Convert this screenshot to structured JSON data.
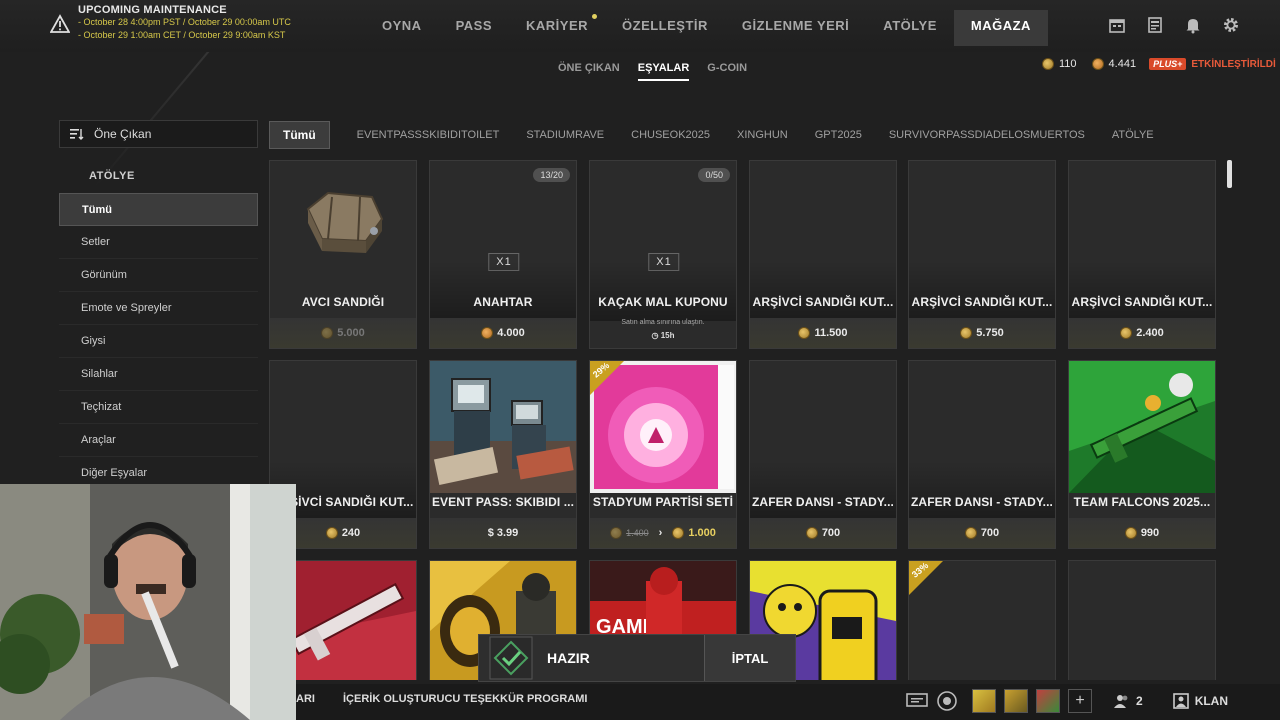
{
  "maintenance": {
    "title": "UPCOMING MAINTENANCE",
    "line1": "- October 28 4:00pm PST / October 29 00:00am UTC",
    "line2": "- October 29 1:00am CET / October 29 9:00am KST"
  },
  "nav": [
    {
      "label": "OYNA"
    },
    {
      "label": "PASS"
    },
    {
      "label": "KARİYER"
    },
    {
      "label": "ÖZELLEŞTİR"
    },
    {
      "label": "GİZLENME YERİ"
    },
    {
      "label": "ATÖLYE"
    },
    {
      "label": "MAĞAZA"
    }
  ],
  "subtabs": [
    "ÖNE ÇIKAN",
    "EŞYALAR",
    "G-COIN"
  ],
  "wallet": {
    "gcoin": "110",
    "bp": "4.441",
    "plus_badge": "PLUS+",
    "plus_status": "ETKİNLEŞTİRİLDİ"
  },
  "sort": {
    "label": "Öne Çıkan"
  },
  "sidebar": {
    "heading": "ATÖLYE",
    "items": [
      "Tümü",
      "Setler",
      "Görünüm",
      "Emote ve Spreyler",
      "Giysi",
      "Silahlar",
      "Teçhizat",
      "Araçlar",
      "Diğer Eşyalar"
    ]
  },
  "filters": [
    "Tümü",
    "EVENTPASSSKIBIDITOILET",
    "STADIUMRAVE",
    "CHUSEOK2025",
    "XINGHUN",
    "GPT2025",
    "SURVIVORPASSDIADELOSMUERTOS",
    "ATÖLYE"
  ],
  "cards": [
    {
      "name": "AVCI SANDIĞI",
      "price": "5.000"
    },
    {
      "name": "ANAHTAR",
      "price": "4.000",
      "counter": "13/20",
      "qty": "X1"
    },
    {
      "name": "KAÇAK MAL KUPONU",
      "counter": "0/50",
      "qty": "X1",
      "note": "Satın alma sınırına ulaştın.",
      "timer": "15h"
    },
    {
      "name": "ARŞİVCİ SANDIĞI KUT...",
      "price": "11.500"
    },
    {
      "name": "ARŞİVCİ SANDIĞI KUT...",
      "price": "5.750"
    },
    {
      "name": "ARŞİVCİ SANDIĞI KUT...",
      "price": "2.400"
    },
    {
      "name": "ARŞİVCİ SANDIĞI KUT...",
      "price": "240"
    },
    {
      "name": "EVENT PASS: SKIBIDI ...",
      "price": "$ 3.99"
    },
    {
      "name": "STADYUM PARTİSİ SETİ",
      "old_price": "1.400",
      "price": "1.000",
      "discount": "29%"
    },
    {
      "name": "ZAFER DANSI - STADY...",
      "price": "700"
    },
    {
      "name": "ZAFER DANSI - STADY...",
      "price": "700"
    },
    {
      "name": "TEAM FALCONS 2025...",
      "price": "990"
    },
    {
      "name": ""
    },
    {
      "name": ""
    },
    {
      "name": ""
    },
    {
      "name": ""
    },
    {
      "name": "",
      "discount": "33%"
    },
    {
      "name": ""
    }
  ],
  "ready": {
    "label": "HAZIR",
    "cancel": "İPTAL"
  },
  "bottom": {
    "left_fragment": "ARI",
    "program": "İÇERİK OLUŞTURUCU TEŞEKKÜR PROGRAMI",
    "party_count": "2",
    "clan": "KLAN"
  },
  "colors": {
    "accent_gold": "#d6c84a",
    "plus_red": "#d94a2a",
    "discount_gold": "#c9a020"
  }
}
